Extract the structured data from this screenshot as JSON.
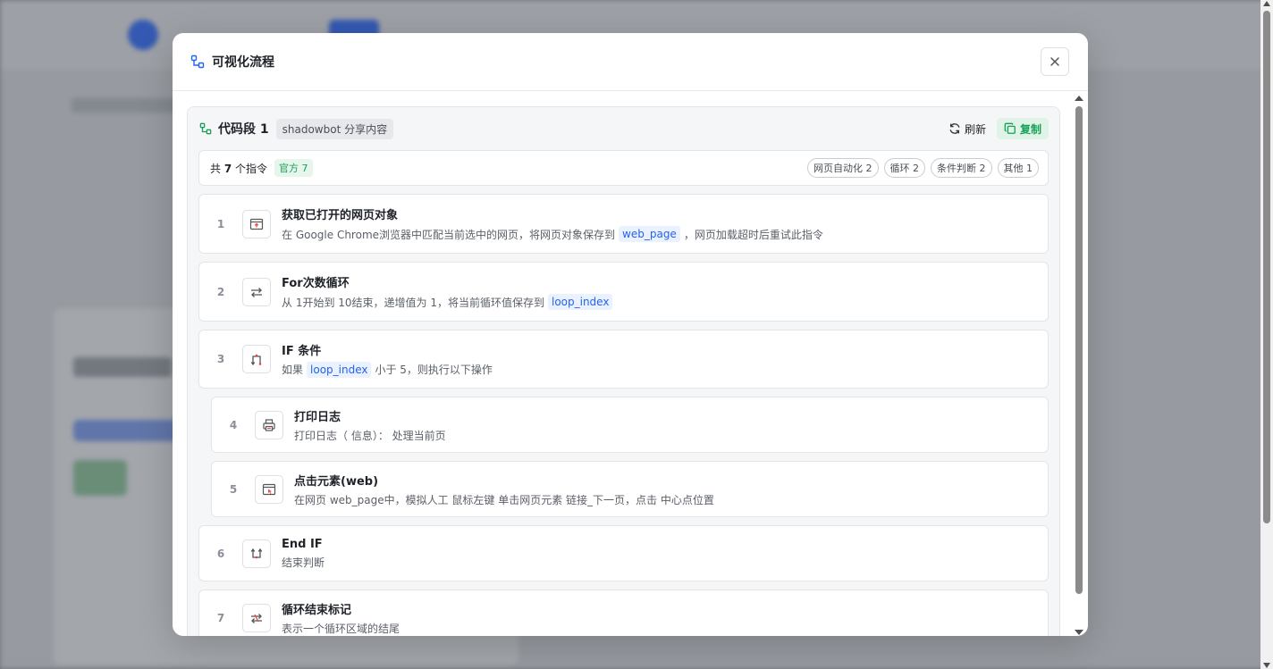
{
  "modal": {
    "title": "可视化流程",
    "close_label": "×"
  },
  "segment": {
    "title": "代码段 1",
    "tag": "shadowbot 分享内容",
    "refresh_label": "刷新",
    "copy_label": "复制"
  },
  "stats": {
    "total_prefix": "共",
    "total_count": "7",
    "total_suffix": "个指令",
    "official": "官方 7",
    "categories": [
      "网页自动化 2",
      "循环 2",
      "条件判断 2",
      "其他 1"
    ]
  },
  "steps": [
    {
      "num": "1",
      "title": "获取已打开的网页对象",
      "desc_a": "在 Google Chrome浏览器中匹配当前选中的网页，将网页对象保存到",
      "var": "web_page",
      "desc_b": "，网页加载超时后重试此指令",
      "icon": "webpage-icon"
    },
    {
      "num": "2",
      "title": "For次数循环",
      "desc_a": "从 1开始到 10结束，递增值为 1，将当前循环值保存到",
      "var": "loop_index",
      "desc_b": "",
      "icon": "loop-icon"
    },
    {
      "num": "3",
      "title": "IF 条件",
      "desc_a": "如果",
      "var": "loop_index",
      "desc_b": "小于 5，则执行以下操作",
      "icon": "branch-icon"
    },
    {
      "num": "4",
      "title": "打印日志",
      "desc_a": "打印日志（ 信息）： 处理当前页",
      "var": "",
      "desc_b": "",
      "icon": "printer-icon"
    },
    {
      "num": "5",
      "title": "点击元素(web)",
      "desc_a": "在网页 web_page中，模拟人工 鼠标左键 单击网页元素 链接_下一页，点击 中心点位置",
      "var": "",
      "desc_b": "",
      "icon": "click-element-icon"
    },
    {
      "num": "6",
      "title": "End IF",
      "desc_a": "结束判断",
      "var": "",
      "desc_b": "",
      "icon": "end-if-icon"
    },
    {
      "num": "7",
      "title": "循环结束标记",
      "desc_a": "表示一个循环区域的结尾",
      "var": "",
      "desc_b": "",
      "icon": "loop-end-icon"
    }
  ],
  "colors": {
    "accent_green": "#18a058",
    "accent_blue": "#2563eb"
  }
}
